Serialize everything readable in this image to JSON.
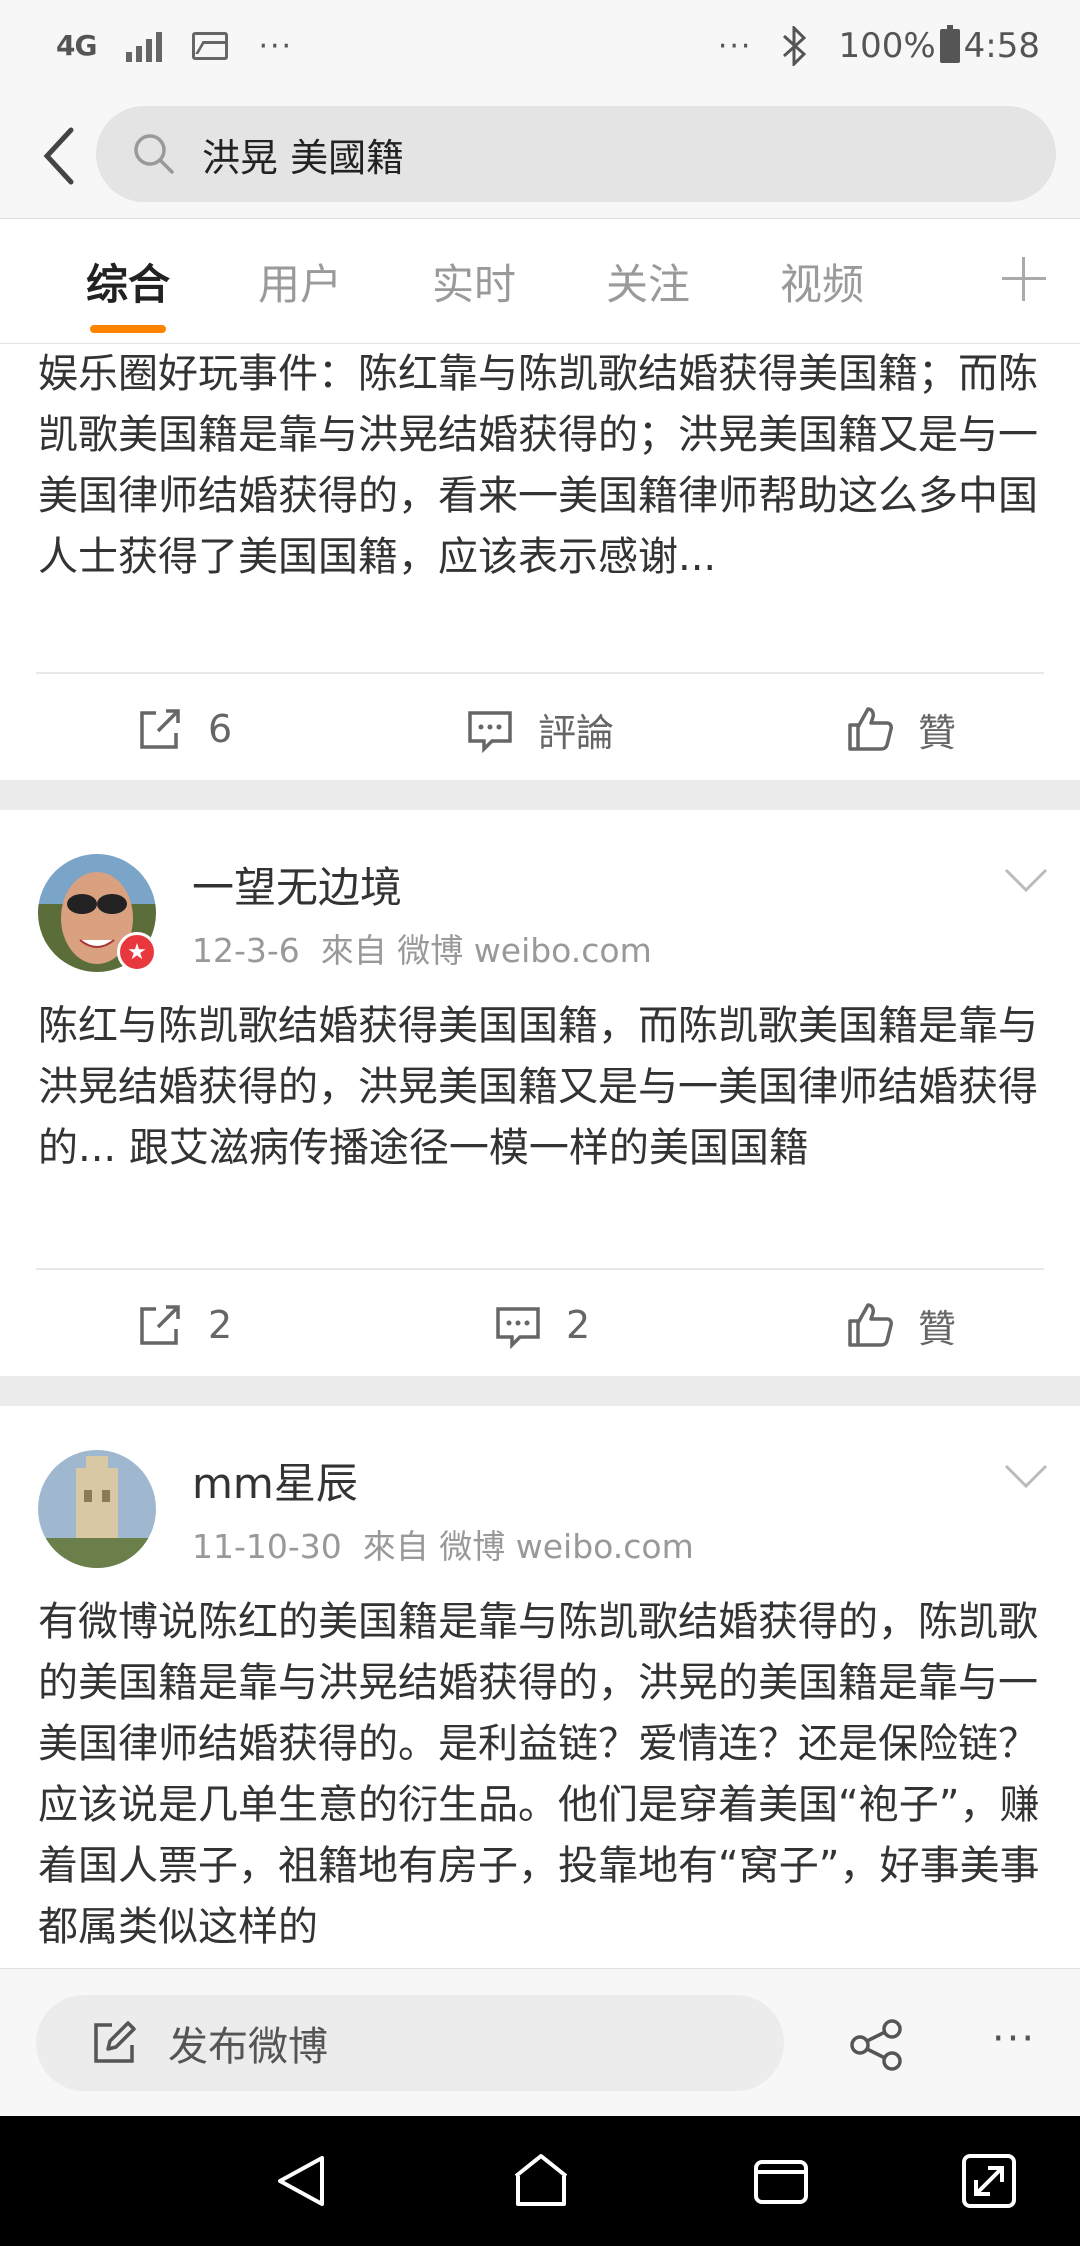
{
  "status_bar": {
    "network": "4G",
    "dots_left": "···",
    "dots_right": "···",
    "battery": "100%",
    "time": "4:58"
  },
  "search": {
    "query": "洪晃 美國籍"
  },
  "tabs": [
    {
      "label": "综合"
    },
    {
      "label": "用户"
    },
    {
      "label": "实时"
    },
    {
      "label": "关注"
    },
    {
      "label": "视频"
    }
  ],
  "posts": [
    {
      "text": "娱乐圈好玩事件：陈红靠与陈凯歌结婚获得美国籍；而陈凯歌美国籍是靠与洪晃结婚获得的；洪晃美国籍又是与一美国律师结婚获得的，看来一美国籍律师帮助这么多中国人士获得了美国国籍，应该表示感谢...",
      "reposts": "6",
      "comments": "評論",
      "likes": "贊"
    },
    {
      "user": "一望无边境",
      "date": "12-3-6",
      "source": "來自 微博 weibo.com",
      "text": "陈红与陈凯歌结婚获得美国国籍，而陈凯歌美国籍是靠与洪晃结婚获得的，洪晃美国籍又是与一美国律师结婚获得的... 跟艾滋病传播途径一模一样的美国国籍",
      "reposts": "2",
      "comments": "2",
      "likes": "贊"
    },
    {
      "user": "mm星辰",
      "date": "11-10-30",
      "source": "來自 微博 weibo.com",
      "text": "有微博说陈红的美国籍是靠与陈凯歌结婚获得的，陈凯歌的美国籍是靠与洪晃结婚获得的，洪晃的美国籍是靠与一美国律师结婚获得的。是利益链？爱情连？还是保险链？应该说是几单生意的衍生品。他们是穿着美国“袍子”，赚着国人票子，祖籍地有房子，投靠地有“窝子”，好事美事都属类似这样的"
    }
  ],
  "bottom_bar": {
    "compose": "发布微博",
    "more": "···"
  },
  "colors": {
    "accent": "#ff8200",
    "badge": "#e8383d"
  }
}
